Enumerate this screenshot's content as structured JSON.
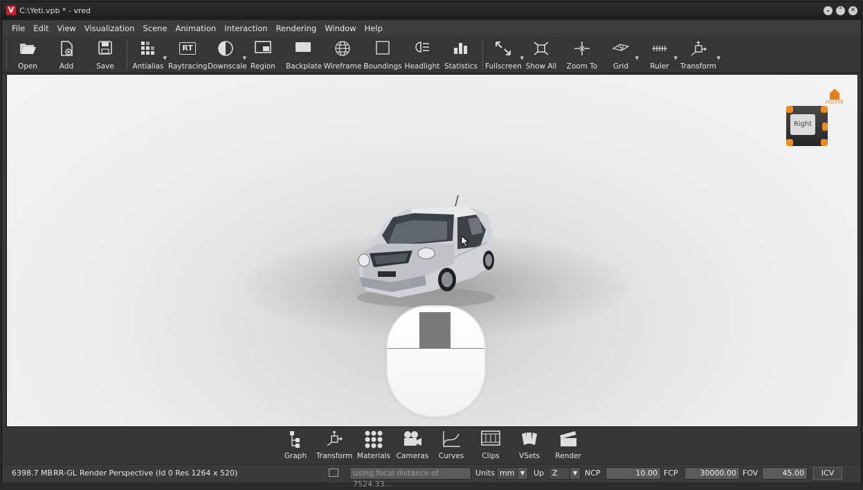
{
  "window": {
    "title": "C:\\Yeti.vpb * - vred",
    "logo": "V",
    "controls": [
      "minimize-icon",
      "maximize-icon",
      "close-icon"
    ]
  },
  "menu": [
    "File",
    "Edit",
    "View",
    "Visualization",
    "Scene",
    "Animation",
    "Interaction",
    "Rendering",
    "Window",
    "Help"
  ],
  "toolbar": {
    "open": "Open",
    "add": "Add",
    "save": "Save",
    "antialias": "Antialias",
    "raytracing": "Raytracing",
    "raytracing_icon_text": "RT",
    "downscale": "Downscale",
    "region": "Region",
    "backplate": "Backplate",
    "wireframe": "Wireframe",
    "boundings": "Boundings",
    "headlight": "Headlight",
    "statistics": "Statistics",
    "fullscreen": "Fullscreen",
    "show_all": "Show All",
    "zoom_to": "Zoom To",
    "grid": "Grid",
    "ruler": "Ruler",
    "transform": "Transform"
  },
  "viewport": {
    "navcube_face": "Right",
    "home_label": "HOME",
    "accent_color": "#f28a1e"
  },
  "dock": {
    "graph": "Graph",
    "transform": "Transform",
    "materials": "Materials",
    "cameras": "Cameras",
    "curves": "Curves",
    "clips": "Clips",
    "vsets": "VSets",
    "render": "Render"
  },
  "status": {
    "memory": "6398.7 MB",
    "renderer": "RR-GL",
    "info": "Render Perspective (Id 0 Res 1264 x 520)",
    "focal_msg": "using focal distance of 7524.33...",
    "units_label": "Units",
    "units_value": "mm",
    "up_label": "Up",
    "up_value": "Z",
    "ncp_label": "NCP",
    "ncp_value": "10.00",
    "fcp_label": "FCP",
    "fcp_value": "30000.00",
    "fov_label": "FOV",
    "fov_value": "45.00",
    "icv_label": "ICV"
  }
}
